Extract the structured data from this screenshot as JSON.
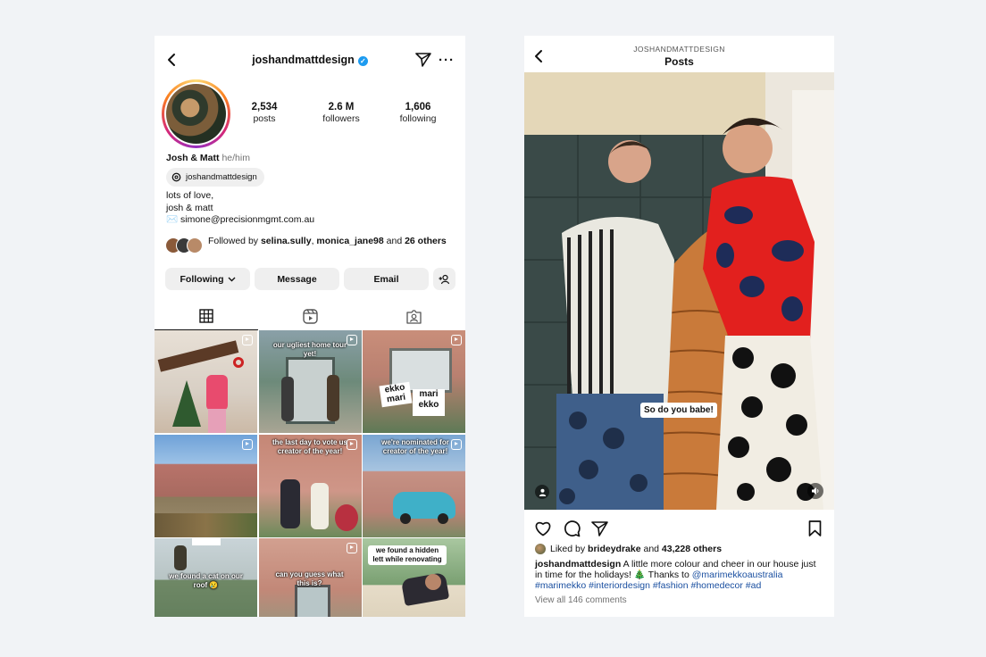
{
  "profile": {
    "username": "joshandmattdesign",
    "verified_icon": "verified-badge-icon",
    "stats": {
      "posts_count": "2,534",
      "posts_label": "posts",
      "followers_count": "2.6 M",
      "followers_label": "followers",
      "following_count": "1,606",
      "following_label": "following"
    },
    "display_name": "Josh & Matt",
    "pronouns": "he/him",
    "threads_handle": "joshandmattdesign",
    "bio_line1": "lots of love,",
    "bio_line2": "josh & matt",
    "bio_email": "✉️ simone@precisionmgmt.com.au",
    "followed_prefix": "Followed by ",
    "followed_user1": "selina.sully",
    "followed_sep": ", ",
    "followed_user2": "monica_jane98",
    "followed_and": " and ",
    "followed_others": "26 others",
    "buttons": {
      "following": "Following",
      "message": "Message",
      "email": "Email"
    },
    "grid_captions": {
      "c2": "our ugliest home tour yet!",
      "c5": "the last day to vote us creator of the year!",
      "c6": "we're nominated for creator of the year!",
      "c7": "we found a cat on our roof 😢",
      "c8": "can you guess what this is?",
      "c9": "we found a hidden lett while renovating"
    }
  },
  "post_view": {
    "username_header": "JOSHANDMATTDESIGN",
    "title": "Posts",
    "sticker_text": "So do you babe!",
    "liked_by_prefix": "Liked by ",
    "liked_by_user": "brideydrake",
    "liked_by_and": " and ",
    "liked_by_others": "43,228 others",
    "caption_user": "joshandmattdesign",
    "caption_text": " A little more colour and cheer in our house just in time for the holidays! 🎄 Thanks to ",
    "caption_mention": "@marimekkoaustralia",
    "caption_tags": "#marimekko #interiordesign #fashion #homedecor #ad",
    "view_comments": "View all 146 comments"
  },
  "colors": {
    "background": "#f1f3f6",
    "verified": "#1d9bf0",
    "link": "#1a4fa0",
    "button_bg": "#efefef"
  }
}
